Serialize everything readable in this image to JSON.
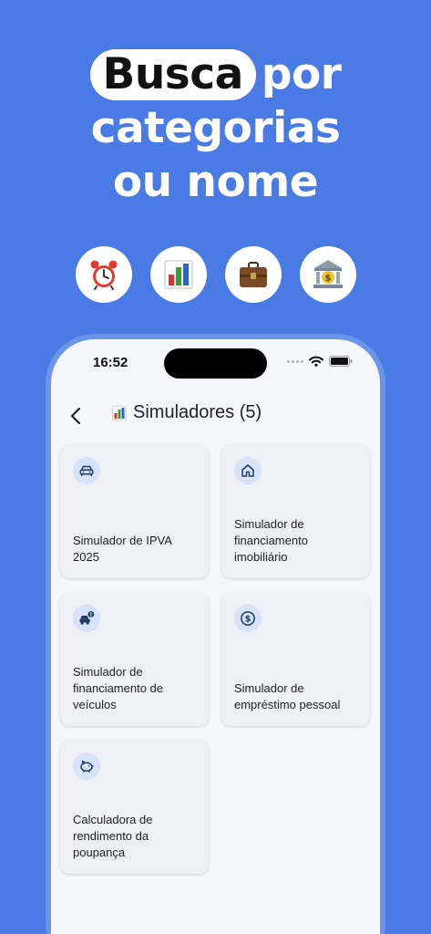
{
  "promo": {
    "highlight": "Busca",
    "line1_rest": "por",
    "line2": "categorias",
    "line3": "ou nome",
    "category_icons": [
      "alarm-clock-icon",
      "bar-chart-icon",
      "briefcase-icon",
      "bank-icon"
    ]
  },
  "status_bar": {
    "time": "16:52"
  },
  "appbar": {
    "title": "Simuladores (5)",
    "title_icon": "bar-chart-icon"
  },
  "cards": [
    {
      "label": "Simulador de IPVA 2025",
      "icon": "car-icon"
    },
    {
      "label": "Simulador de financiamento imobiliário",
      "icon": "home-icon"
    },
    {
      "label": "Simulador de financiamento de veículos",
      "icon": "car-alert-icon"
    },
    {
      "label": "Simulador de empréstimo pessoal",
      "icon": "dollar-circle-icon"
    },
    {
      "label": "Calculadora de rendimento da poupança",
      "icon": "piggy-bank-icon"
    }
  ],
  "colors": {
    "background": "#4a7be4",
    "card": "#eff0f6",
    "icon_bubble": "#d7e3f8",
    "icon_stroke": "#1f3a63"
  }
}
